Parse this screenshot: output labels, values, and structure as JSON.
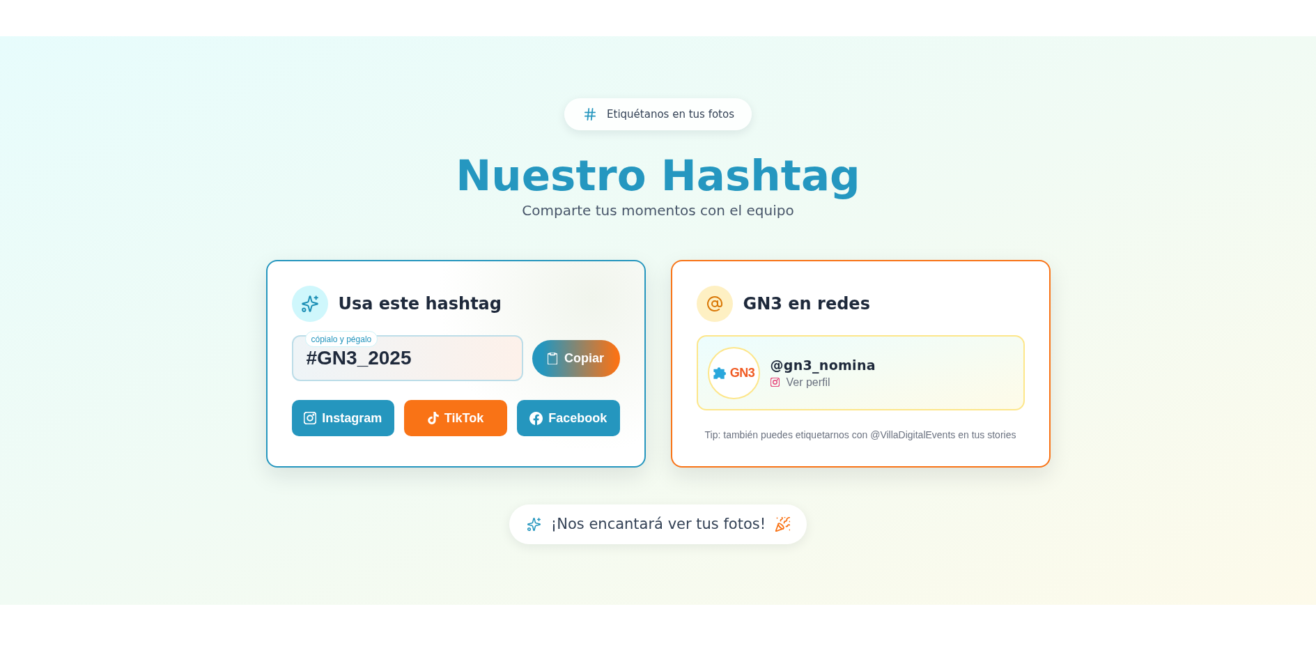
{
  "badge": {
    "text": "Etiquétanos en tus fotos"
  },
  "header": {
    "title": "Nuestro Hashtag",
    "subtitle": "Comparte tus momentos con el equipo"
  },
  "hashtag_card": {
    "title": "Usa este hashtag",
    "hashtag_field": {
      "label": "cópialo y pégalo",
      "value": "#GN3_2025"
    },
    "copy_button": "Copiar",
    "social_buttons": [
      {
        "kind": "instagram",
        "label": "Instagram",
        "color": "#2596be"
      },
      {
        "kind": "tiktok",
        "label": "TikTok",
        "color": "#f97316"
      },
      {
        "kind": "facebook",
        "label": "Facebook",
        "color": "#2596be"
      }
    ]
  },
  "social_card": {
    "title": "GN3 en redes",
    "profile": {
      "logo_text": "GN3",
      "handle": "@gn3_nomina",
      "link": "Ver perfil"
    },
    "tip": "Tip: también puedes etiquetarnos con @VillaDigitalEvents en tus stories"
  },
  "footer_pill": {
    "text": "¡Nos encantará ver tus fotos!"
  }
}
